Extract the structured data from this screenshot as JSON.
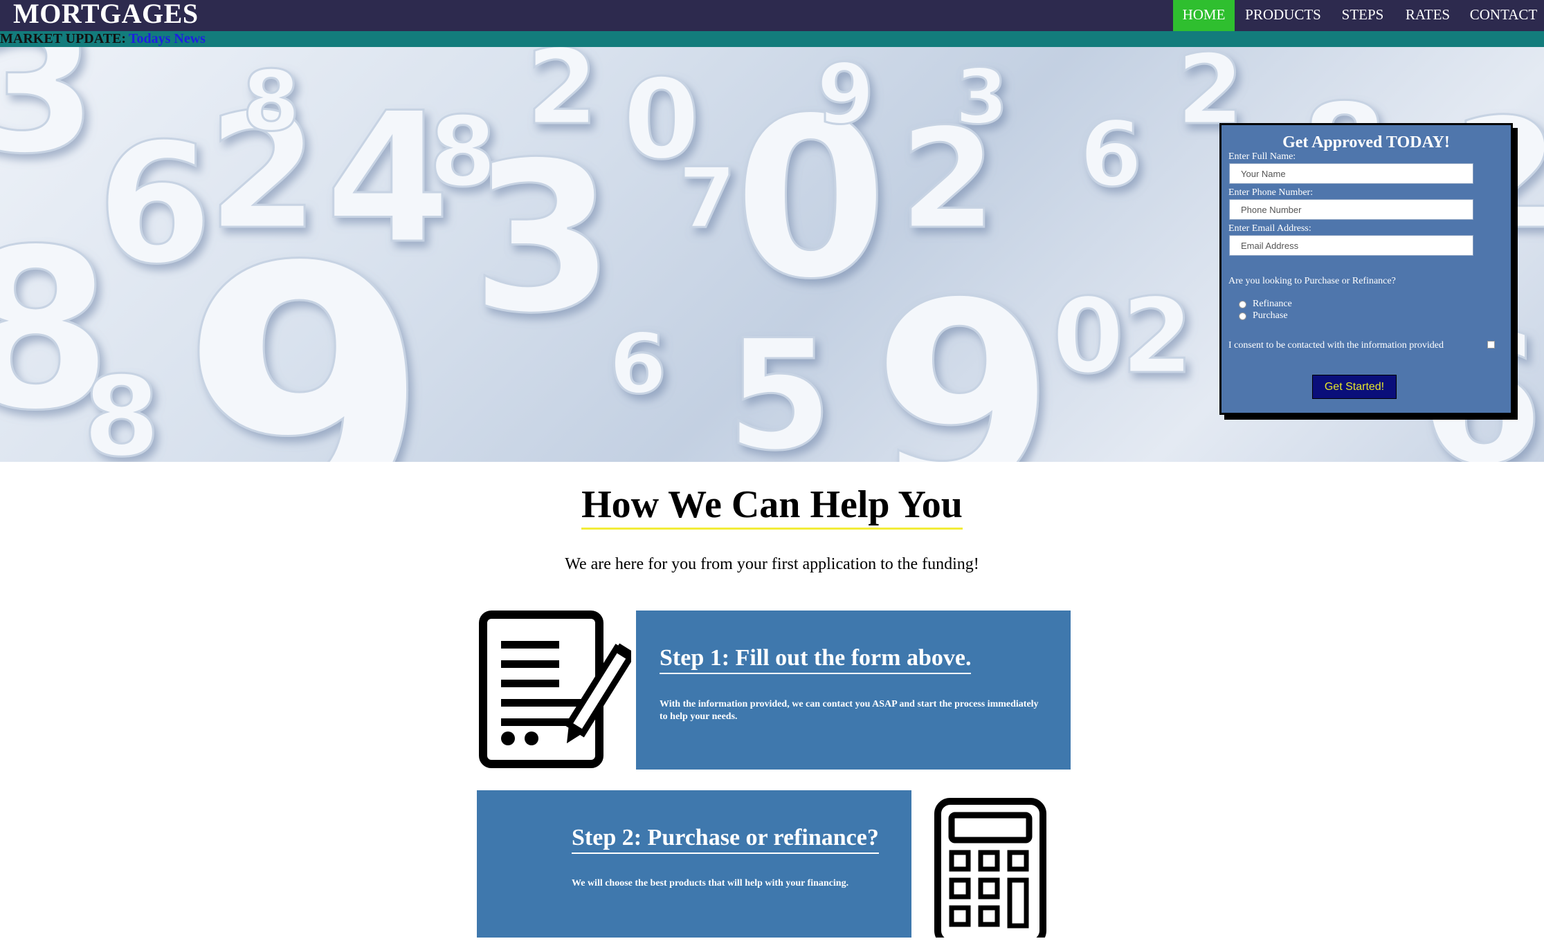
{
  "nav": {
    "brand": "MORTGAGES",
    "items": [
      {
        "label": "HOME",
        "active": true
      },
      {
        "label": "PRODUCTS",
        "active": false
      },
      {
        "label": "STEPS",
        "active": false
      },
      {
        "label": "RATES",
        "active": false
      },
      {
        "label": "CONTACT",
        "active": false
      }
    ]
  },
  "ticker": {
    "label": "MARKET UPDATE:",
    "link": "Todays News"
  },
  "hero": {
    "image": "3d-numbers-background"
  },
  "form": {
    "title": "Get Approved TODAY!",
    "name_label": "Enter Full Name:",
    "name_placeholder": "Your Name",
    "phone_label": "Enter Phone Number:",
    "phone_placeholder": "Phone Number",
    "email_label": "Enter Email Address:",
    "email_placeholder": "Email Address",
    "question": "Are you looking to Purchase or Refinance?",
    "options": [
      "Refinance",
      "Purchase"
    ],
    "consent": "I consent to be contacted with the information provided",
    "submit": "Get Started!"
  },
  "section": {
    "title": "How We Can Help You",
    "subtitle": "We are here for you from your first application to the funding!"
  },
  "steps": [
    {
      "title": "Step 1: Fill out the form above.",
      "text": "With the information provided, we can contact you ASAP and start the process immediately to help your needs.",
      "icon": "document-pen-icon"
    },
    {
      "title": "Step 2: Purchase or refinance?",
      "text": "We will choose the best products that will help with your financing.",
      "icon": "calculator-icon"
    }
  ],
  "colors": {
    "nav_bg": "#2d2a4e",
    "nav_active": "#2fbf2f",
    "ticker_bg": "#137c7c",
    "card_bg": "#3f78ad",
    "form_bg": "#4f76ac",
    "title_underline": "#f2ec3a"
  }
}
